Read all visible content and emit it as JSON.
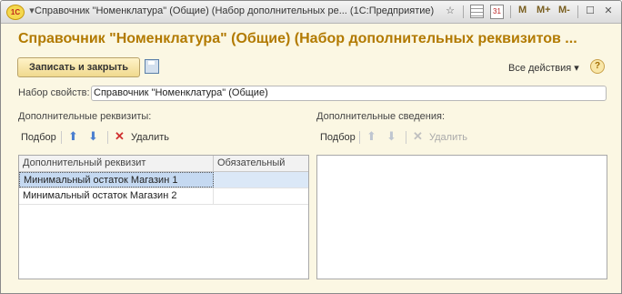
{
  "window": {
    "title": "Справочник \"Номенклатура\" (Общие) (Набор дополнительных ре...  (1С:Предприятие)",
    "app_icon": "1С",
    "controls": {
      "memory": "M",
      "memory_plus": "M+",
      "memory_minus": "M-",
      "calendar": "31",
      "minimize": "–",
      "maximize": "☐",
      "close": "✕"
    }
  },
  "form": {
    "title": "Справочник \"Номенклатура\" (Общие) (Набор дополнительных реквизитов ...",
    "save_close_label": "Записать и закрыть",
    "all_actions_label": "Все действия ▾",
    "help_label": "?"
  },
  "property_set": {
    "label": "Набор свойств:",
    "value": "Справочник \"Номенклатура\" (Общие)"
  },
  "left": {
    "heading": "Дополнительные реквизиты:",
    "pick_label": "Подбор",
    "delete_label": "Удалить",
    "columns": [
      "Дополнительный реквизит",
      "Обязательный"
    ],
    "rows": [
      {
        "name": "Минимальный остаток Магазин 1",
        "required": ""
      },
      {
        "name": "Минимальный остаток Магазин 2",
        "required": ""
      }
    ]
  },
  "right": {
    "heading": "Дополнительные сведения:",
    "pick_label": "Подбор",
    "delete_label": "Удалить"
  },
  "colors": {
    "title_accent": "#b27a00",
    "background": "#fbf7e3",
    "selection": "#c5d9f1"
  }
}
